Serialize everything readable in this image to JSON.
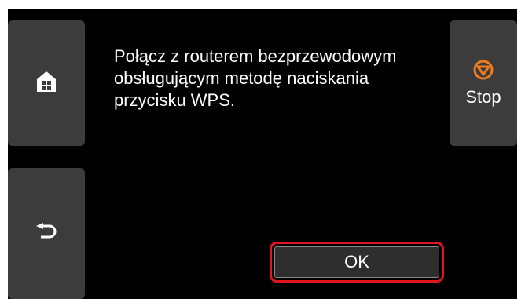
{
  "screen": {
    "message": "Połącz z routerem bezprzewodowym\nobsługującym metodę naciskania\nprzycisku WPS."
  },
  "buttons": {
    "home_icon": "home-icon",
    "back_icon": "back-arrow-icon",
    "stop_icon": "stop-icon",
    "stop_label": "Stop",
    "ok_label": "OK"
  },
  "colors": {
    "screen_bg": "#000000",
    "button_bg": "#3c3c3c",
    "stop_icon": "#f07c1e",
    "highlight": "#e0161d"
  }
}
